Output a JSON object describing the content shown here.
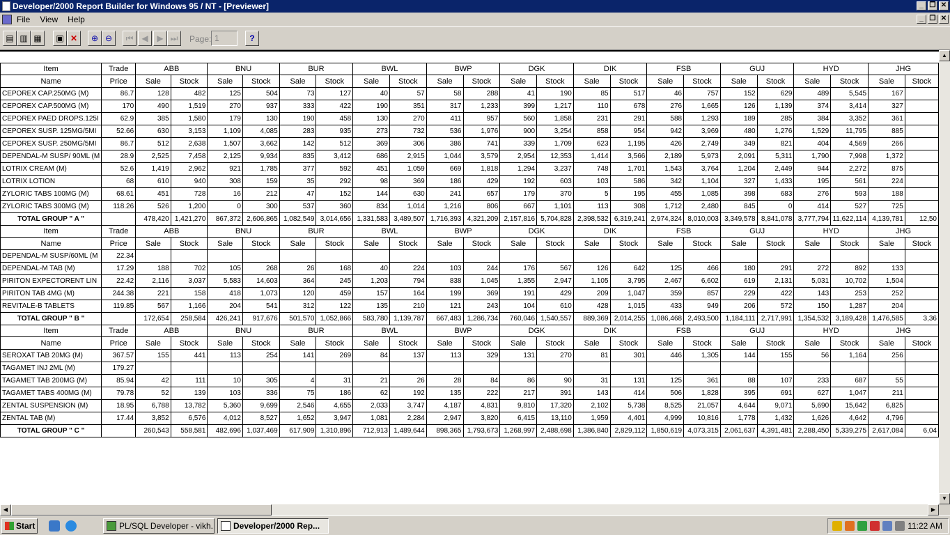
{
  "window": {
    "title": "Developer/2000 Report Builder for Windows 95 / NT - [Previewer]"
  },
  "menu": {
    "items": [
      "File",
      "View",
      "Help"
    ]
  },
  "toolbar": {
    "page_label": "Page:",
    "page_value": "1",
    "help_label": "?"
  },
  "report": {
    "col_item": "Item",
    "col_name": "Name",
    "col_trade": "Trade",
    "col_price": "Price",
    "sale": "Sale",
    "stock": "Stock",
    "regions": [
      "ABB",
      "BNU",
      "BUR",
      "BWL",
      "BWP",
      "DGK",
      "DIK",
      "FSB",
      "GUJ",
      "HYD",
      "JHG"
    ],
    "groups": [
      {
        "rows": [
          {
            "name": "CEPOREX CAP.250MG (M)",
            "price": "86.7",
            "values": [
              "128",
              "482",
              "125",
              "504",
              "73",
              "127",
              "40",
              "57",
              "58",
              "288",
              "41",
              "190",
              "85",
              "517",
              "46",
              "757",
              "152",
              "629",
              "489",
              "5,545",
              "167",
              ""
            ]
          },
          {
            "name": "CEPOREX CAP.500MG (M)",
            "price": "170",
            "values": [
              "490",
              "1,519",
              "270",
              "937",
              "333",
              "422",
              "190",
              "351",
              "317",
              "1,233",
              "399",
              "1,217",
              "110",
              "678",
              "276",
              "1,665",
              "126",
              "1,139",
              "374",
              "3,414",
              "327",
              ""
            ]
          },
          {
            "name": "CEPOREX PAED DROPS.125I",
            "price": "62.9",
            "values": [
              "385",
              "1,580",
              "179",
              "130",
              "190",
              "458",
              "130",
              "270",
              "411",
              "957",
              "560",
              "1,858",
              "231",
              "291",
              "588",
              "1,293",
              "189",
              "285",
              "384",
              "3,352",
              "361",
              ""
            ]
          },
          {
            "name": "CEPOREX SUSP. 125MG/5MI",
            "price": "52.66",
            "values": [
              "630",
              "3,153",
              "1,109",
              "4,085",
              "283",
              "935",
              "273",
              "732",
              "536",
              "1,976",
              "900",
              "3,254",
              "858",
              "954",
              "942",
              "3,969",
              "480",
              "1,276",
              "1,529",
              "11,795",
              "885",
              ""
            ]
          },
          {
            "name": "CEPOREX SUSP. 250MG/5MI",
            "price": "86.7",
            "values": [
              "512",
              "2,638",
              "1,507",
              "3,662",
              "142",
              "512",
              "369",
              "306",
              "386",
              "741",
              "339",
              "1,709",
              "623",
              "1,195",
              "426",
              "2,749",
              "349",
              "821",
              "404",
              "4,569",
              "266",
              ""
            ]
          },
          {
            "name": "DEPENDAL-M SUSP/ 90ML (M",
            "price": "28.9",
            "values": [
              "2,525",
              "7,458",
              "2,125",
              "9,934",
              "835",
              "3,412",
              "686",
              "2,915",
              "1,044",
              "3,579",
              "2,954",
              "12,353",
              "1,414",
              "3,566",
              "2,189",
              "5,973",
              "2,091",
              "5,311",
              "1,790",
              "7,998",
              "1,372",
              ""
            ]
          },
          {
            "name": "LOTRIX CREAM (M)",
            "price": "52.6",
            "values": [
              "1,419",
              "2,962",
              "921",
              "1,785",
              "377",
              "592",
              "451",
              "1,059",
              "669",
              "1,818",
              "1,294",
              "3,237",
              "748",
              "1,701",
              "1,543",
              "3,764",
              "1,204",
              "2,449",
              "944",
              "2,272",
              "875",
              ""
            ]
          },
          {
            "name": "LOTRIX LOTION",
            "price": "68",
            "values": [
              "610",
              "940",
              "308",
              "159",
              "35",
              "292",
              "98",
              "369",
              "186",
              "429",
              "192",
              "603",
              "103",
              "586",
              "342",
              "1,104",
              "327",
              "1,433",
              "195",
              "561",
              "224",
              ""
            ]
          },
          {
            "name": "ZYLORIC TABS 100MG (M)",
            "price": "68.61",
            "values": [
              "451",
              "728",
              "16",
              "212",
              "47",
              "152",
              "144",
              "630",
              "241",
              "657",
              "179",
              "370",
              "5",
              "195",
              "455",
              "1,085",
              "398",
              "683",
              "276",
              "593",
              "188",
              ""
            ]
          },
          {
            "name": "ZYLORIC TABS 300MG (M)",
            "price": "118.26",
            "values": [
              "526",
              "1,200",
              "0",
              "300",
              "537",
              "360",
              "834",
              "1,014",
              "1,216",
              "806",
              "667",
              "1,101",
              "113",
              "308",
              "1,712",
              "2,480",
              "845",
              "0",
              "414",
              "527",
              "725",
              ""
            ]
          }
        ],
        "total": {
          "label": "TOTAL GROUP \" A \"",
          "values": [
            "478,420",
            "1,421,270",
            "867,372",
            "2,606,865",
            "1,082,549",
            "3,014,656",
            "1,331,583",
            "3,489,507",
            "1,716,393",
            "4,321,209",
            "2,157,816",
            "5,704,828",
            "2,398,532",
            "6,319,241",
            "2,974,324",
            "8,010,003",
            "3,349,578",
            "8,841,078",
            "3,777,794",
            "11,622,114",
            "4,139,781",
            "12,50"
          ]
        }
      },
      {
        "rows": [
          {
            "name": "DEPENDAL-M SUSP/60ML (M",
            "price": "22.34",
            "values": [
              "",
              "",
              "",
              "",
              "",
              "",
              "",
              "",
              "",
              "",
              "",
              "",
              "",
              "",
              "",
              "",
              "",
              "",
              "",
              "",
              "",
              ""
            ]
          },
          {
            "name": "DEPENDAL-M TAB (M)",
            "price": "17.29",
            "values": [
              "188",
              "702",
              "105",
              "268",
              "26",
              "168",
              "40",
              "224",
              "103",
              "244",
              "176",
              "567",
              "126",
              "642",
              "125",
              "466",
              "180",
              "291",
              "272",
              "892",
              "133",
              ""
            ]
          },
          {
            "name": "PIRITON EXPECTORENT LIN",
            "price": "22.42",
            "values": [
              "2,116",
              "3,037",
              "5,583",
              "14,603",
              "364",
              "245",
              "1,203",
              "794",
              "838",
              "1,045",
              "1,355",
              "2,947",
              "1,105",
              "3,795",
              "2,467",
              "6,602",
              "619",
              "2,131",
              "5,031",
              "10,702",
              "1,504",
              ""
            ]
          },
          {
            "name": "PIRITON TAB 4MG (M)",
            "price": "244.38",
            "values": [
              "221",
              "158",
              "418",
              "1,073",
              "120",
              "459",
              "157",
              "164",
              "199",
              "369",
              "191",
              "429",
              "209",
              "1,047",
              "359",
              "857",
              "229",
              "422",
              "143",
              "253",
              "252",
              ""
            ]
          },
          {
            "name": "REVITALE-B TABLETS",
            "price": "119.85",
            "values": [
              "567",
              "1,166",
              "204",
              "541",
              "312",
              "122",
              "135",
              "210",
              "121",
              "243",
              "104",
              "610",
              "428",
              "1,015",
              "433",
              "949",
              "206",
              "572",
              "150",
              "1,287",
              "204",
              ""
            ]
          }
        ],
        "total": {
          "label": "TOTAL GROUP \" B \"",
          "values": [
            "172,654",
            "258,584",
            "426,241",
            "917,676",
            "501,570",
            "1,052,866",
            "583,780",
            "1,139,787",
            "667,483",
            "1,286,734",
            "760,046",
            "1,540,557",
            "889,369",
            "2,014,255",
            "1,086,468",
            "2,493,500",
            "1,184,111",
            "2,717,991",
            "1,354,532",
            "3,189,428",
            "1,476,585",
            "3,36"
          ]
        }
      },
      {
        "rows": [
          {
            "name": "SEROXAT TAB 20MG (M)",
            "price": "367.57",
            "values": [
              "155",
              "441",
              "113",
              "254",
              "141",
              "269",
              "84",
              "137",
              "113",
              "329",
              "131",
              "270",
              "81",
              "301",
              "446",
              "1,305",
              "144",
              "155",
              "56",
              "1,164",
              "256",
              ""
            ]
          },
          {
            "name": "TAGAMET INJ 2ML (M)",
            "price": "179.27",
            "values": [
              "",
              "",
              "",
              "",
              "",
              "",
              "",
              "",
              "",
              "",
              "",
              "",
              "",
              "",
              "",
              "",
              "",
              "",
              "",
              "",
              "",
              ""
            ]
          },
          {
            "name": "TAGAMET TAB 200MG (M)",
            "price": "85.94",
            "values": [
              "42",
              "111",
              "10",
              "305",
              "4",
              "31",
              "21",
              "26",
              "28",
              "84",
              "86",
              "90",
              "31",
              "131",
              "125",
              "361",
              "88",
              "107",
              "233",
              "687",
              "55",
              ""
            ]
          },
          {
            "name": "TAGAMET TABS 400MG (M)",
            "price": "79.78",
            "values": [
              "52",
              "139",
              "103",
              "336",
              "75",
              "186",
              "62",
              "192",
              "135",
              "222",
              "217",
              "391",
              "143",
              "414",
              "506",
              "1,828",
              "395",
              "691",
              "627",
              "1,047",
              "211",
              ""
            ]
          },
          {
            "name": "ZENTAL SUSPENSION (M)",
            "price": "18.95",
            "values": [
              "6,788",
              "13,782",
              "5,360",
              "9,699",
              "2,546",
              "4,655",
              "2,033",
              "3,747",
              "4,187",
              "4,831",
              "9,810",
              "17,320",
              "2,102",
              "5,738",
              "8,525",
              "21,057",
              "4,644",
              "9,071",
              "5,690",
              "15,642",
              "6,825",
              ""
            ]
          },
          {
            "name": "ZENTAL TAB (M)",
            "price": "17.44",
            "values": [
              "3,852",
              "6,576",
              "4,012",
              "8,527",
              "1,652",
              "3,947",
              "1,081",
              "2,284",
              "2,947",
              "3,820",
              "6,415",
              "13,110",
              "1,959",
              "4,401",
              "4,999",
              "10,816",
              "1,778",
              "1,432",
              "1,626",
              "4,642",
              "4,796",
              ""
            ]
          }
        ],
        "total": {
          "label": "TOTAL GROUP \" C \"",
          "values": [
            "260,543",
            "558,581",
            "482,696",
            "1,037,469",
            "617,909",
            "1,310,896",
            "712,913",
            "1,489,644",
            "898,365",
            "1,793,673",
            "1,268,997",
            "2,488,698",
            "1,386,840",
            "2,829,112",
            "1,850,619",
            "4,073,315",
            "2,061,637",
            "4,391,481",
            "2,288,450",
            "5,339,275",
            "2,617,084",
            "6,04"
          ]
        }
      }
    ]
  },
  "taskbar": {
    "start": "Start",
    "tasks": [
      {
        "label": "PL/SQL Developer - vikh..."
      },
      {
        "label": "Developer/2000 Rep..."
      }
    ],
    "clock": "11:22 AM"
  }
}
